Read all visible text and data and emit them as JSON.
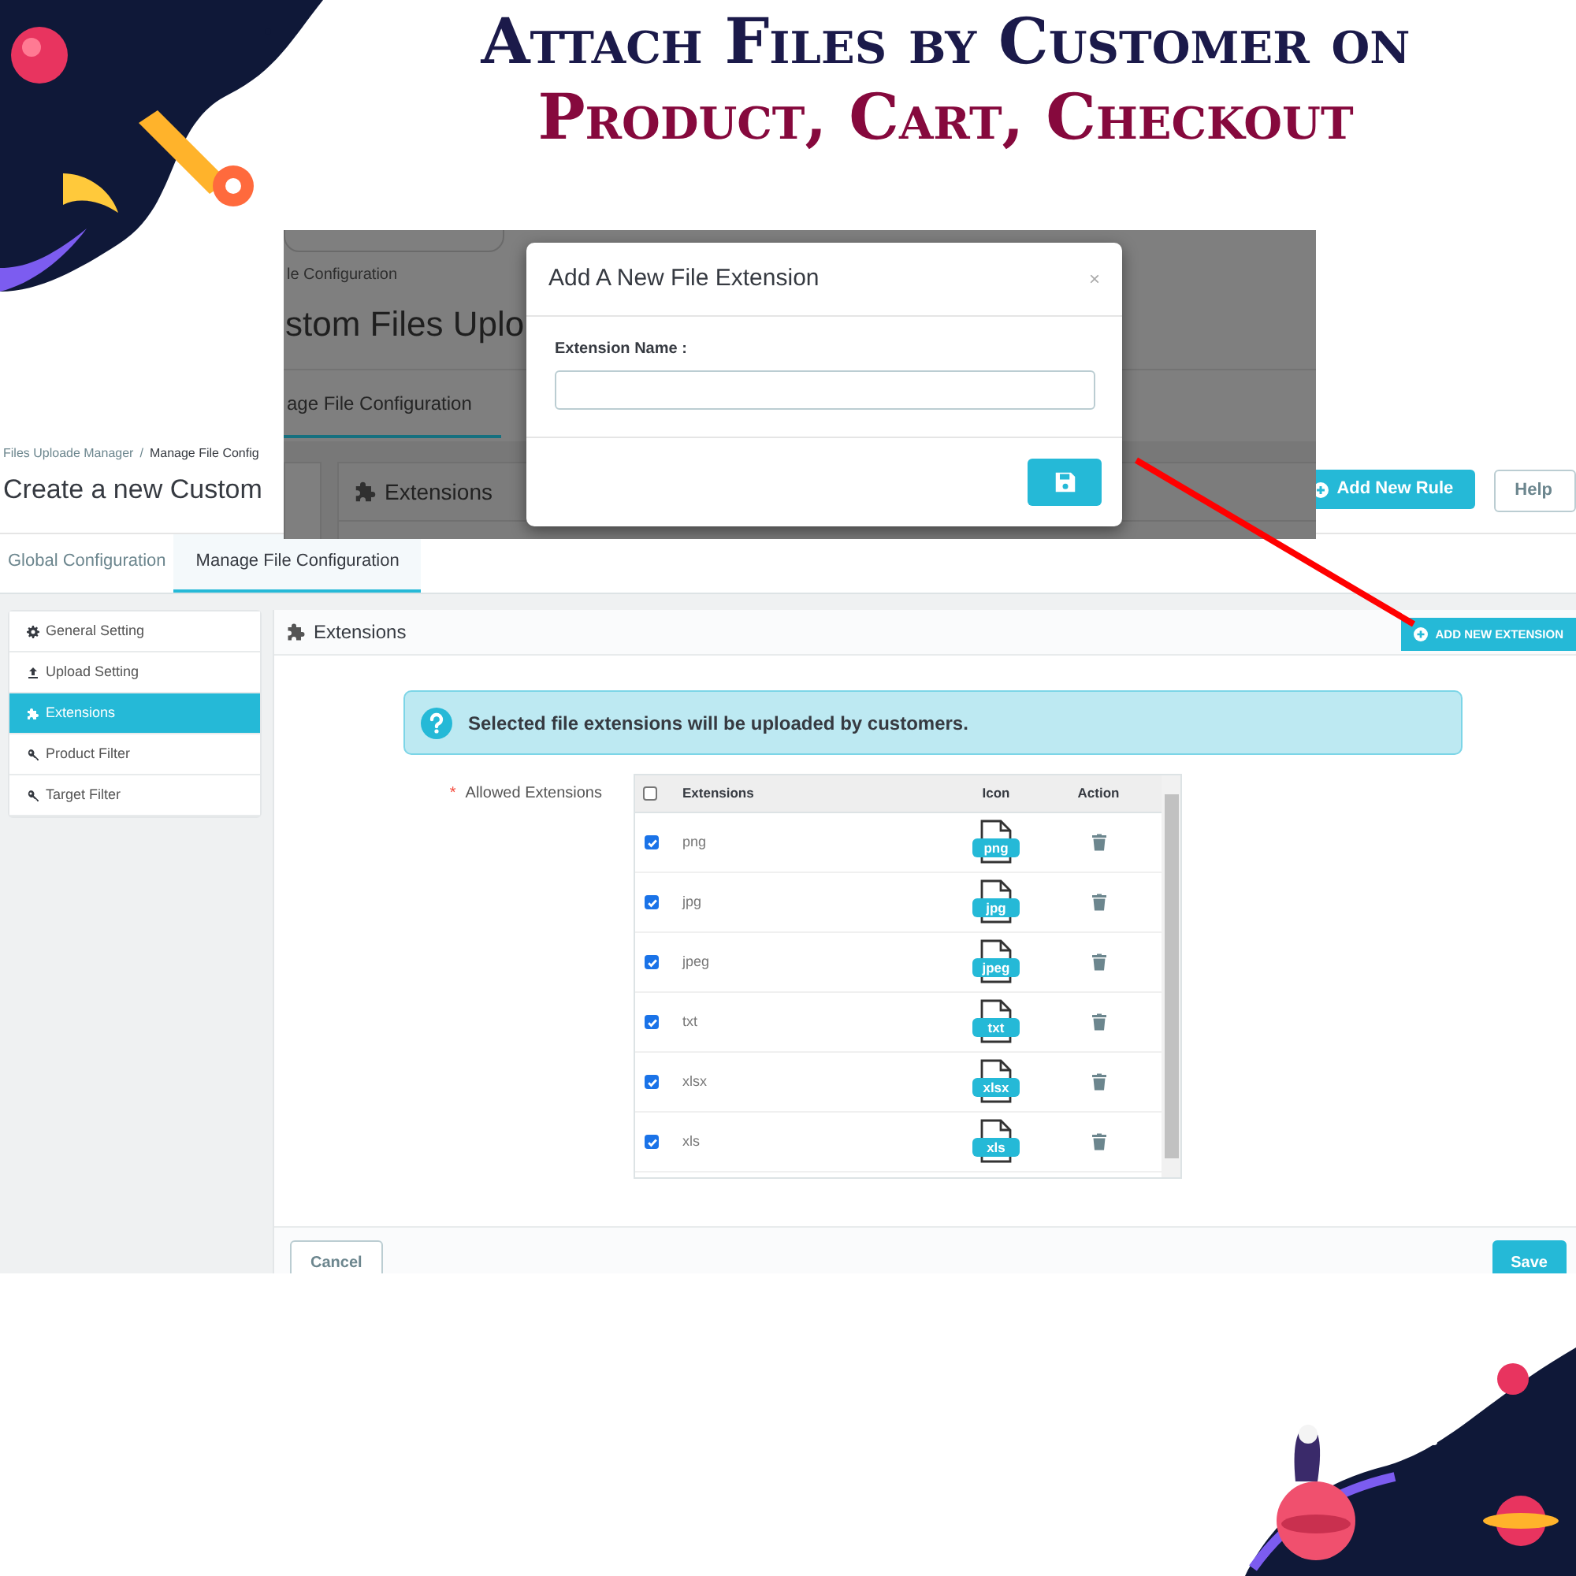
{
  "banner": {
    "line_1": "Attach Files by Customer on",
    "line_2": "Product, Cart, Checkout"
  },
  "page": {
    "breadcrumb": [
      "Files Uploade Manager",
      "/",
      "Manage File Config"
    ],
    "title": "Create a new Custom",
    "header_buttons": [
      {
        "label": "Add New Rule",
        "kind": "primary"
      },
      {
        "label": "Help",
        "kind": "outline"
      }
    ],
    "tabs": [
      {
        "label": "Global Configuration",
        "selected": false
      },
      {
        "label": "Manage File Configuration",
        "selected": true
      }
    ],
    "sidebar": {
      "items": [
        {
          "label": "General Setting",
          "selected": false
        },
        {
          "label": "Upload Setting",
          "selected": false
        },
        {
          "label": "Extensions",
          "selected": true
        },
        {
          "label": "Product Filter",
          "selected": false
        },
        {
          "label": "Target Filter",
          "selected": false
        }
      ]
    },
    "panel": {
      "title": "Extensions",
      "add_button": "ADD NEW EXTENSION",
      "alert": "Selected file extensions will be uploaded by customers.",
      "field_label": "Allowed Extensions",
      "required_mark": "*",
      "table": {
        "columns": [
          "Extensions",
          "Icon",
          "Action"
        ],
        "header_checked": false,
        "rows": [
          {
            "name": "png",
            "badge": "png",
            "checked": true
          },
          {
            "name": "jpg",
            "badge": "jpg",
            "checked": true
          },
          {
            "name": "jpeg",
            "badge": "jpeg",
            "checked": true
          },
          {
            "name": "txt",
            "badge": "txt",
            "checked": true
          },
          {
            "name": "xlsx",
            "badge": "xlsx",
            "checked": true
          },
          {
            "name": "xls",
            "badge": "xls",
            "checked": true
          }
        ]
      },
      "footer_buttons": [
        {
          "label": "Cancel",
          "kind": "outline"
        },
        {
          "label": "Save",
          "kind": "primary"
        }
      ]
    }
  },
  "overlay": {
    "background": {
      "breadcrumb": "le Configuration",
      "title": "stom Files Uplo",
      "tab": "age File Configuration",
      "panel_title": "Extensions"
    },
    "modal": {
      "title": "Add A New File Extension",
      "close": "×",
      "field_label": "Extension Name :"
    }
  }
}
